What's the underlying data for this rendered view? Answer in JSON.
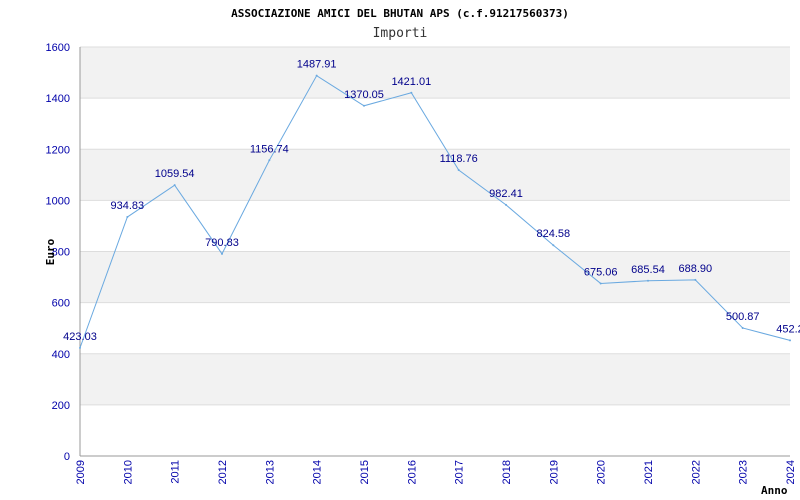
{
  "chart_data": {
    "type": "line",
    "title": "ASSOCIAZIONE AMICI DEL BHUTAN APS (c.f.91217560373)",
    "subtitle": "Importi",
    "xlabel": "Anno",
    "ylabel": "Euro",
    "categories": [
      "2009",
      "2010",
      "2011",
      "2012",
      "2013",
      "2014",
      "2015",
      "2016",
      "2017",
      "2018",
      "2019",
      "2020",
      "2021",
      "2022",
      "2023",
      "2024"
    ],
    "series": [
      {
        "values": [
          423.03,
          934.83,
          1059.54,
          790.83,
          1156.74,
          1487.91,
          1370.05,
          1421.01,
          1118.76,
          982.41,
          824.58,
          675.06,
          685.54,
          688.9,
          500.87,
          452.2
        ],
        "labels": [
          "423.03",
          "934.83",
          "1059.54",
          "790.83",
          "1156.74",
          "1487.91",
          "1370.05",
          "1421.01",
          "1118.76",
          "982.41",
          "824.58",
          "675.06",
          "685.54",
          "688.90",
          "500.87",
          "452.2"
        ],
        "color": "#6aa9e0"
      }
    ],
    "yticks": [
      0,
      200,
      400,
      600,
      800,
      1000,
      1200,
      1400,
      1600
    ],
    "ylim": [
      0,
      1600
    ],
    "grid": true
  }
}
